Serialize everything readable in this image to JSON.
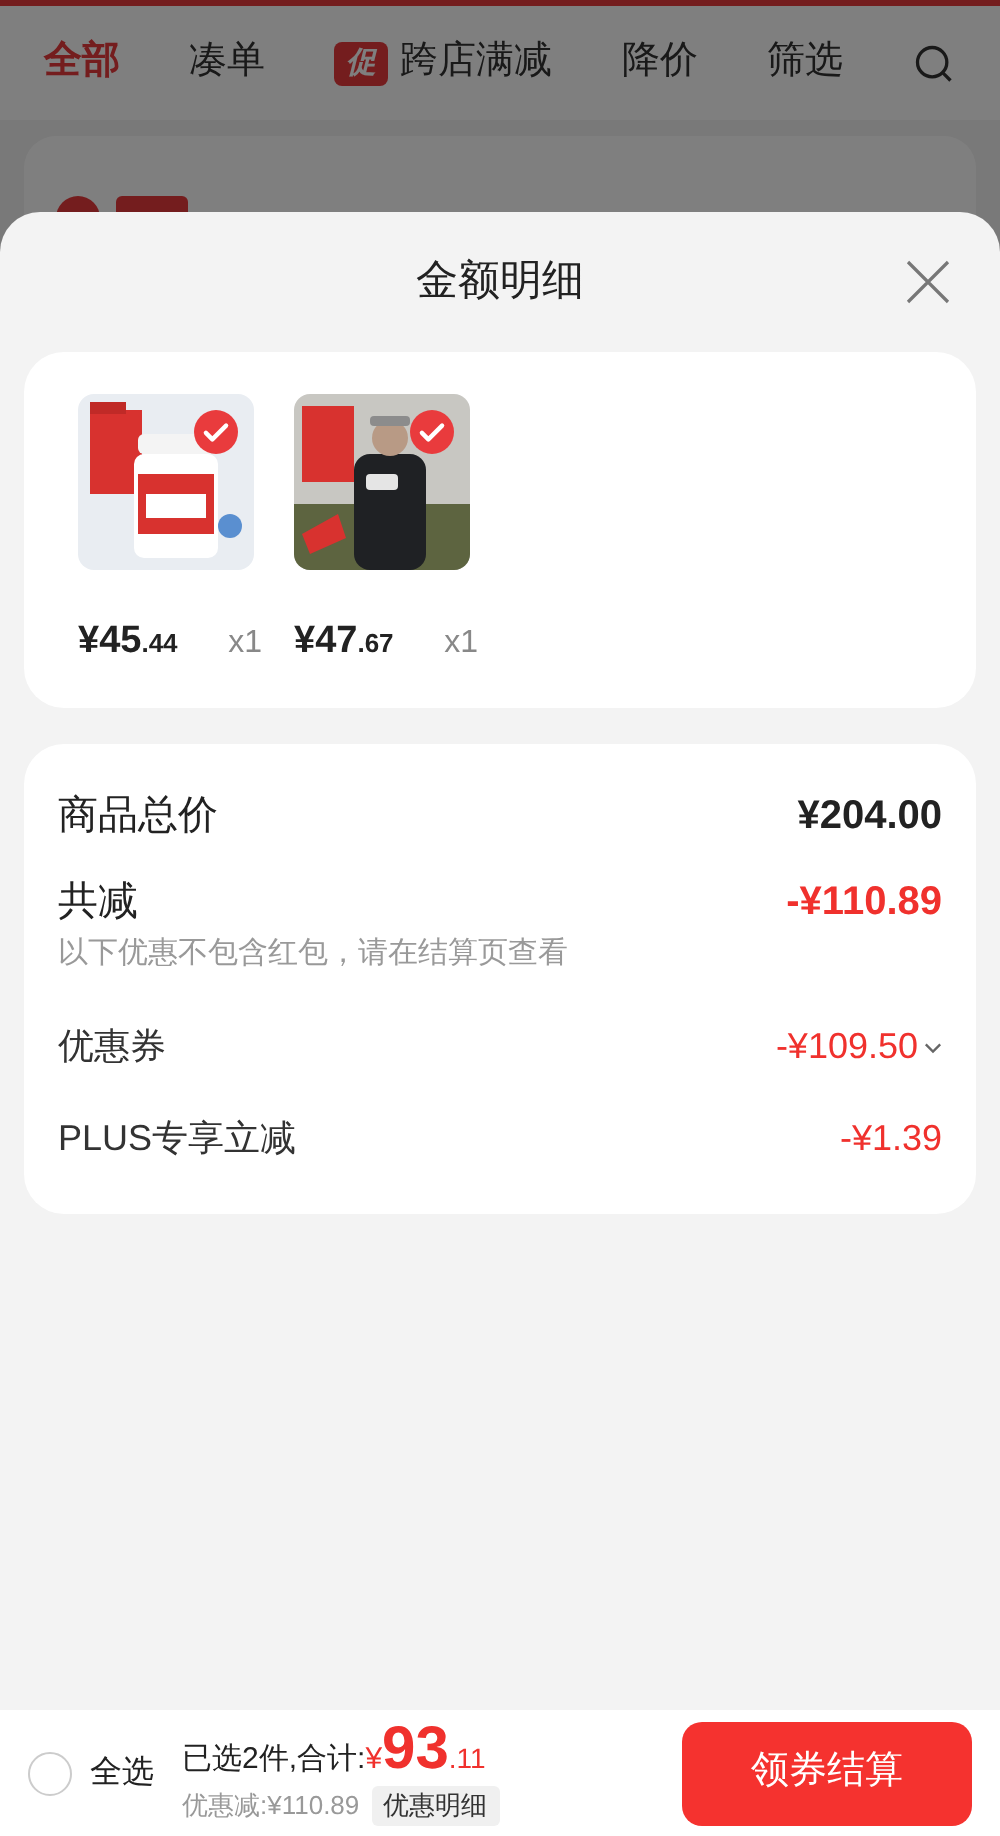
{
  "tabs": [
    {
      "label": "全部",
      "selected": true
    },
    {
      "label": "凑单",
      "selected": false
    },
    {
      "label": "跨店满减",
      "selected": false,
      "badge": "促"
    },
    {
      "label": "降价",
      "selected": false
    },
    {
      "label": "筛选",
      "selected": false
    }
  ],
  "sheet": {
    "title": "金额明细",
    "products": [
      {
        "selected": true,
        "price_main": "¥45",
        "price_decimal": ".44",
        "quantity": "x1"
      },
      {
        "selected": true,
        "price_main": "¥47",
        "price_decimal": ".67",
        "quantity": "x1"
      }
    ],
    "summary": [
      {
        "kind": "total",
        "label": "商品总价",
        "value": "¥204.00"
      },
      {
        "kind": "discount_total",
        "label": "共减",
        "value": "-¥110.89",
        "note": "以下优惠不包含红包，请在结算页查看"
      },
      {
        "kind": "item",
        "label": "优惠券",
        "value": "-¥109.50",
        "expandable": true
      },
      {
        "kind": "item",
        "label": "PLUS专享立减",
        "value": "-¥1.39",
        "expandable": false
      }
    ]
  },
  "bottom_bar": {
    "select_all": {
      "label": "全选",
      "checked": false
    },
    "selected_count": "已选2件,合计:",
    "currency": "¥",
    "total_main": "93",
    "total_decimal": ".11",
    "discount": "优惠减:¥110.89",
    "details_button": "优惠明细",
    "checkout_button": "领券结算"
  }
}
